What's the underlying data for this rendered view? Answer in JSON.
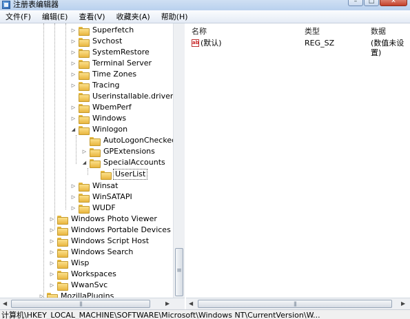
{
  "window": {
    "title": "注册表编辑器",
    "buttons": {
      "minimize": "–",
      "maximize": "□",
      "close": "✕"
    }
  },
  "menu": [
    "文件(F)",
    "编辑(E)",
    "查看(V)",
    "收藏夹(A)",
    "帮助(H)"
  ],
  "tree": [
    {
      "label": "Superfetch",
      "expander": "▷"
    },
    {
      "label": "Svchost",
      "expander": "▷"
    },
    {
      "label": "SystemRestore",
      "expander": "▷"
    },
    {
      "label": "Terminal Server",
      "expander": "▷"
    },
    {
      "label": "Time Zones",
      "expander": "▷"
    },
    {
      "label": "Tracing",
      "expander": "▷"
    },
    {
      "label": "Userinstallable.drivers",
      "expander": ""
    },
    {
      "label": "WbemPerf",
      "expander": "▷"
    },
    {
      "label": "Windows",
      "expander": "▷"
    },
    {
      "label": "Winlogon",
      "expander": "◢"
    },
    {
      "label": "AutoLogonChecked",
      "expander": ""
    },
    {
      "label": "GPExtensions",
      "expander": "▷"
    },
    {
      "label": "SpecialAccounts",
      "expander": "◢"
    },
    {
      "label": "UserList",
      "expander": "",
      "selected": true
    },
    {
      "label": "Winsat",
      "expander": "▷"
    },
    {
      "label": "WinSATAPI",
      "expander": "▷"
    },
    {
      "label": "WUDF",
      "expander": "▷"
    },
    {
      "label": "Windows Photo Viewer",
      "expander": "▷"
    },
    {
      "label": "Windows Portable Devices",
      "expander": "▷"
    },
    {
      "label": "Windows Script Host",
      "expander": "▷"
    },
    {
      "label": "Windows Search",
      "expander": "▷"
    },
    {
      "label": "Wisp",
      "expander": "▷"
    },
    {
      "label": "Workspaces",
      "expander": "▷"
    },
    {
      "label": "WwanSvc",
      "expander": "▷"
    },
    {
      "label": "MozillaPlugins",
      "expander": "▷"
    }
  ],
  "list": {
    "columns": [
      "名称",
      "类型",
      "数据"
    ],
    "rows": [
      {
        "icon": "ab",
        "name": "(默认)",
        "type": "REG_SZ",
        "data": "(数值未设置)"
      }
    ]
  },
  "scrollbars": {
    "left_arrow": "◀",
    "right_arrow": "▶"
  },
  "status": "计算机\\HKEY_LOCAL_MACHINE\\SOFTWARE\\Microsoft\\Windows NT\\CurrentVersion\\W..."
}
